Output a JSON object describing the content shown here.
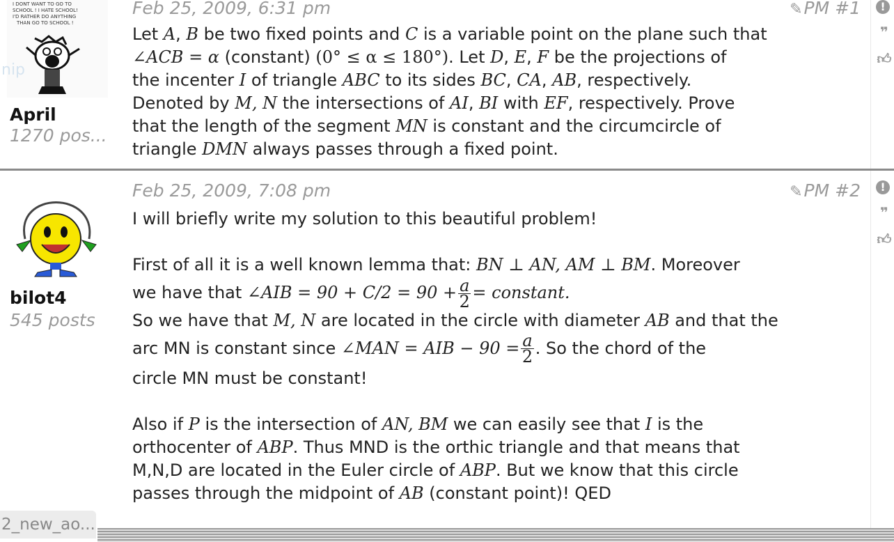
{
  "posts": [
    {
      "author": "April",
      "post_count": "1270 pos...",
      "date": "Feb 25, 2009, 6:31 pm",
      "pm_label": "PM #1",
      "avatar_caption_lines": [
        "I DONT WANT TO GO TO",
        "SCHOOL ! I HATE SCHOOL!",
        "I'D RATHER DO ANYTHING",
        "THAN GO TO SCHOOL !"
      ],
      "ghost_text": "nip"
    },
    {
      "author": "bilot4",
      "post_count": "545 posts",
      "date": "Feb 25, 2009, 7:08 pm",
      "pm_label": "PM #2"
    }
  ],
  "post1_body": {
    "l1a": "Let ",
    "A": "A",
    "c1": ", ",
    "B": "B",
    "l1b": " be two fixed points and ",
    "C": "C",
    "l1c": " is a variable point on the plane such that",
    "angle": "∠ACB = α",
    "l2a": " (constant) ",
    "range": "(0° ≤ α ≤ 180°)",
    "l2b": ". Let ",
    "D": "D",
    "E": "E",
    "F": "F",
    "l2c": " be the projections of",
    "l3a": "the incenter ",
    "I": "I",
    "l3b": " of triangle ",
    "ABC": "ABC",
    "l3c": " to its sides ",
    "BC": "BC",
    "CA": "CA",
    "AB": "AB",
    "l3d": ", respectively.",
    "l4a": "Denoted by ",
    "MN": "M, N",
    "l4b": " the intersections of ",
    "AI": "AI",
    "BI": "BI",
    "l4c": " with ",
    "EF": "EF",
    "l4d": ", respectively. Prove",
    "l5a": "that the length of the segment ",
    "MNseg": "MN",
    "l5b": " is constant and the circumcircle of",
    "l6a": "triangle ",
    "DMN": "DMN",
    "l6b": " always passes through a fixed point."
  },
  "post2_body": {
    "p1": "I will briefly write my solution to this beautiful problem!",
    "p2a": "First of all it is a well known lemma that: ",
    "perp": "BN ⊥ AN, AM ⊥ BM",
    "p2b": ". Moreover",
    "p3a": "we have that ",
    "eq1": "∠AIB = 90 + C/2 = 90 +",
    "frac_num": "a",
    "frac_den": "2",
    "eq1b": "= constant.",
    "p4a": "So we have that ",
    "MNpts": "M, N",
    "p4b": " are located in the circle with diameter ",
    "ABd": "AB",
    "p4c": " and that the",
    "p5a": "arc MN is constant since ",
    "eq2": "∠MAN = AIB − 90 =",
    "p5b": ". So the chord of the",
    "p6": "circle MN must be constant!",
    "p7a": "Also if ",
    "P": "P",
    "p7b": " is the intersection of ",
    "ANBM": "AN, BM",
    "p7c": " we can easily see that ",
    "I2": "I",
    "p7d": " is the",
    "p8a": "orthocenter of ",
    "ABP": "ABP",
    "p8b": ". Thus MND is the orthic triangle and that means that",
    "p9a": "M,N,D are located in the Euler circle of ",
    "ABP2": "ABP",
    "p9b": ". But we know that this circle",
    "p10a": "passes through the midpoint of ",
    "AB2": "AB",
    "p10b": " (constant point)! QED"
  },
  "sidebar_icons": [
    "report-icon",
    "quote-icon",
    "like-icon"
  ],
  "bottom_tab": "2_new_ao..."
}
